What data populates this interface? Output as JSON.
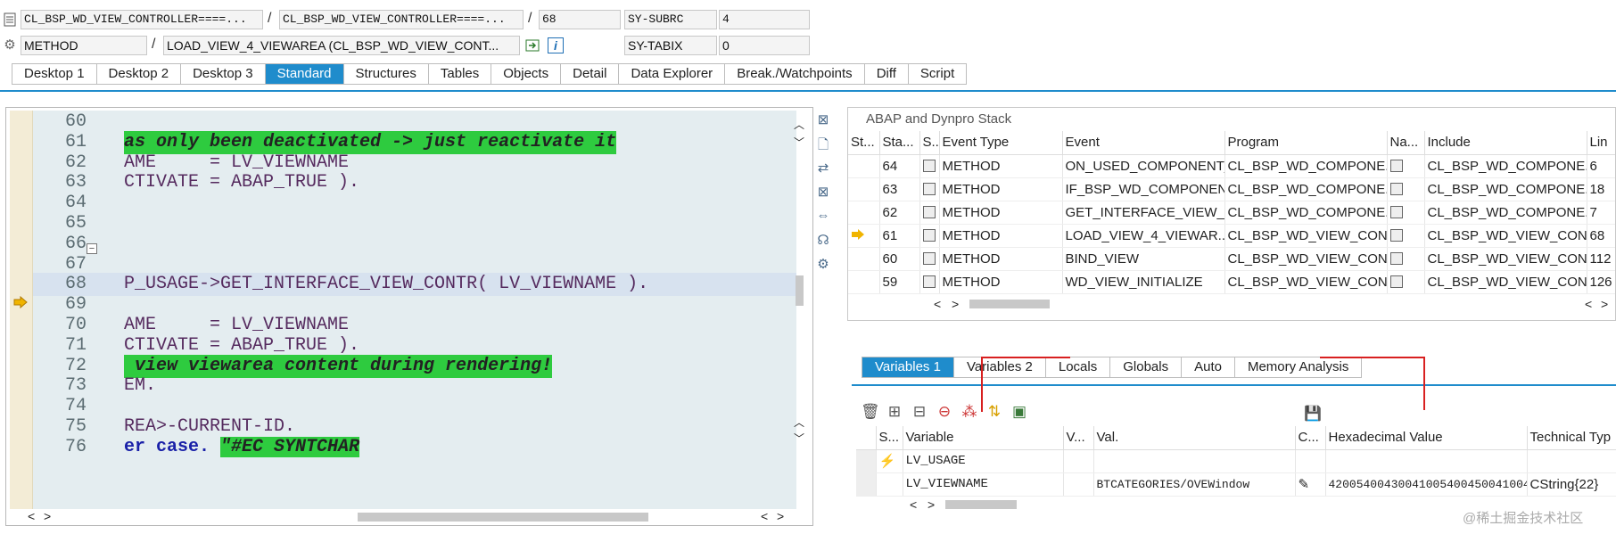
{
  "top_fields": {
    "row1": {
      "class_left": "CL_BSP_WD_VIEW_CONTROLLER====...",
      "class_right": "CL_BSP_WD_VIEW_CONTROLLER====...",
      "line": "68",
      "sysvar_name": "SY-SUBRC",
      "sysvar_value": "4"
    },
    "row2": {
      "type": "METHOD",
      "method": "LOAD_VIEW_4_VIEWAREA (CL_BSP_WD_VIEW_CONT...",
      "sysvar_name": "SY-TABIX",
      "sysvar_value": "0"
    },
    "separator": "/"
  },
  "tabs": [
    "Desktop 1",
    "Desktop 2",
    "Desktop 3",
    "Standard",
    "Structures",
    "Tables",
    "Objects",
    "Detail",
    "Data Explorer",
    "Break./Watchpoints",
    "Diff",
    "Script"
  ],
  "active_tab": "Standard",
  "code": {
    "lines": [
      {
        "n": "60",
        "text": ""
      },
      {
        "n": "61",
        "text": "as only been deactivated -> just reactivate it",
        "style": "comment"
      },
      {
        "n": "62",
        "text": "AME     = LV_VIEWNAME"
      },
      {
        "n": "63",
        "text": "CTIVATE = ABAP_TRUE )."
      },
      {
        "n": "64",
        "text": ""
      },
      {
        "n": "65",
        "text": ""
      },
      {
        "n": "66",
        "text": ""
      },
      {
        "n": "67",
        "text": ""
      },
      {
        "n": "68",
        "text": "P_USAGE->GET_INTERFACE_VIEW_CONTR( LV_VIEWNAME ).",
        "current": true
      },
      {
        "n": "69",
        "text": ""
      },
      {
        "n": "70",
        "text": "AME     = LV_VIEWNAME"
      },
      {
        "n": "71",
        "text": "CTIVATE = ABAP_TRUE )."
      },
      {
        "n": "72",
        "text": " view viewarea content during rendering!",
        "style": "comment"
      },
      {
        "n": "73",
        "text": "EM."
      },
      {
        "n": "74",
        "text": ""
      },
      {
        "n": "75",
        "text": "REA>-CURRENT-ID."
      },
      {
        "n": "76",
        "kw": "er case.",
        "text": " ",
        "pragma": "\"#EC SYNTCHAR"
      }
    ]
  },
  "stack": {
    "title": "ABAP and Dynpro Stack",
    "headers": [
      "St...",
      "Sta...",
      "S...",
      "Event Type",
      "Event",
      "Program",
      "Na...",
      "Include",
      "Lin"
    ],
    "rows": [
      {
        "level": "64",
        "type": "METHOD",
        "event": "ON_USED_COMPONENT_...",
        "program": "CL_BSP_WD_COMPONE...",
        "include": "CL_BSP_WD_COMPONE...",
        "line": "6"
      },
      {
        "level": "63",
        "type": "METHOD",
        "event": "IF_BSP_WD_COMPONEN...",
        "program": "CL_BSP_WD_COMPONE...",
        "include": "CL_BSP_WD_COMPONE...",
        "line": "18"
      },
      {
        "level": "62",
        "type": "METHOD",
        "event": "GET_INTERFACE_VIEW_...",
        "program": "CL_BSP_WD_COMPONE...",
        "include": "CL_BSP_WD_COMPONE...",
        "line": "7"
      },
      {
        "level": "61",
        "type": "METHOD",
        "event": "LOAD_VIEW_4_VIEWAR...",
        "program": "CL_BSP_WD_VIEW_CON...",
        "include": "CL_BSP_WD_VIEW_CON...",
        "line": "68",
        "current": true
      },
      {
        "level": "60",
        "type": "METHOD",
        "event": "BIND_VIEW",
        "program": "CL_BSP_WD_VIEW_CON...",
        "include": "CL_BSP_WD_VIEW_CON...",
        "line": "112"
      },
      {
        "level": "59",
        "type": "METHOD",
        "event": "WD_VIEW_INITIALIZE",
        "program": "CL_BSP_WD_VIEW_CON...",
        "include": "CL_BSP_WD_VIEW_CON...",
        "line": "126"
      }
    ]
  },
  "var_tabs": [
    "Variables 1",
    "Variables 2",
    "Locals",
    "Globals",
    "Auto",
    "Memory Analysis"
  ],
  "active_var_tab": "Variables 1",
  "variables": {
    "headers": [
      "S...",
      "Variable",
      "V...",
      "Val.",
      "C...",
      "Hexadecimal Value",
      "Technical Typ"
    ],
    "rows": [
      {
        "name": "LV_USAGE",
        "value": "",
        "hex": "",
        "type": ""
      },
      {
        "name": "LV_VIEWNAME",
        "value": "BTCATEGORIES/OVEWindow",
        "hex": "42005400430041005400450041004500...",
        "type": "CString{22}"
      }
    ]
  },
  "watermark": "@稀土掘金技术社区",
  "colors": {
    "accent": "#1f8ccc",
    "comment_highlight": "#2ecb3f",
    "code_bg": "#e4edf0",
    "gutter": "#f3ecd6",
    "annotation": "#d82020"
  }
}
